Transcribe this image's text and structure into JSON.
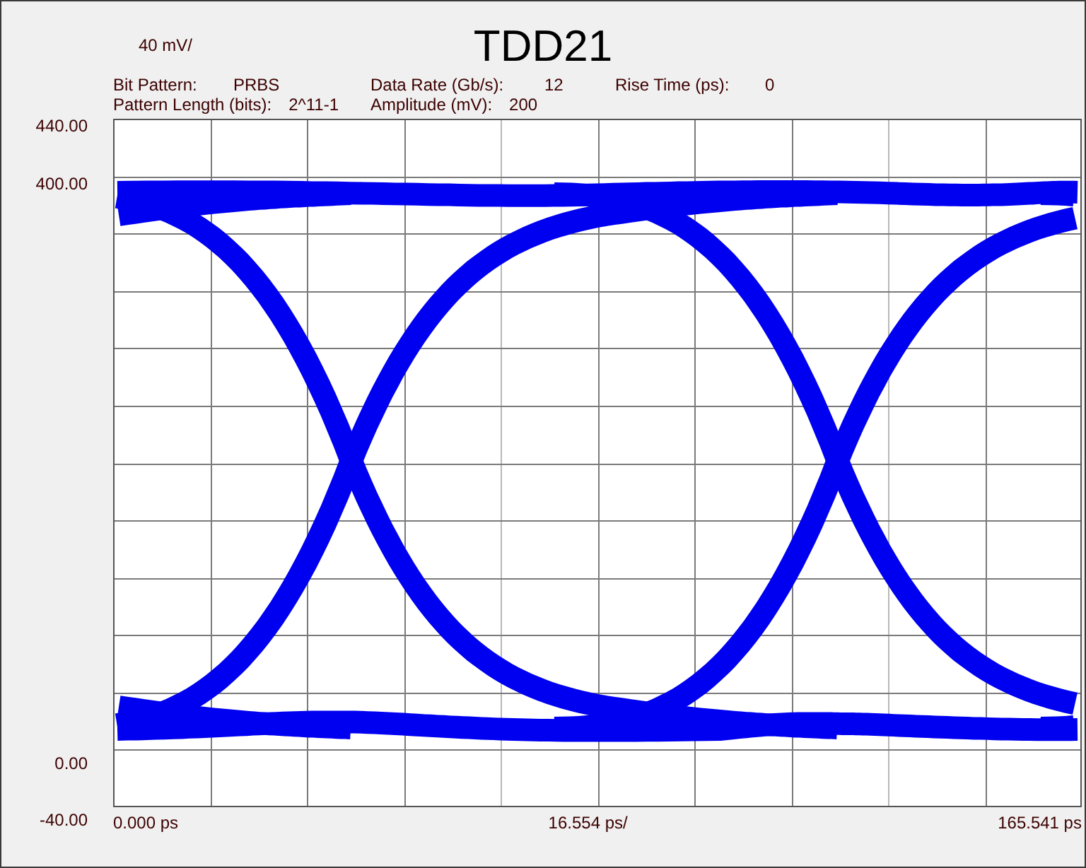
{
  "window": {
    "title": "TDD21"
  },
  "scale": "40 mV/",
  "parameters": [
    {
      "label": "Bit Pattern:",
      "value": "PRBS"
    },
    {
      "label": "Data Rate (Gb/s):",
      "value": "12"
    },
    {
      "label": "Rise Time (ps):",
      "value": "0"
    },
    {
      "label": "Pattern Length (bits):",
      "value": "2^11-1"
    },
    {
      "label": "Amplitude (mV):",
      "value": "200"
    }
  ],
  "y_labels": [
    "440.00",
    "400.00",
    "0.00",
    "-40.00"
  ],
  "x_labels": [
    "0.000 ps",
    "16.554 ps/",
    "165.541 ps"
  ]
}
